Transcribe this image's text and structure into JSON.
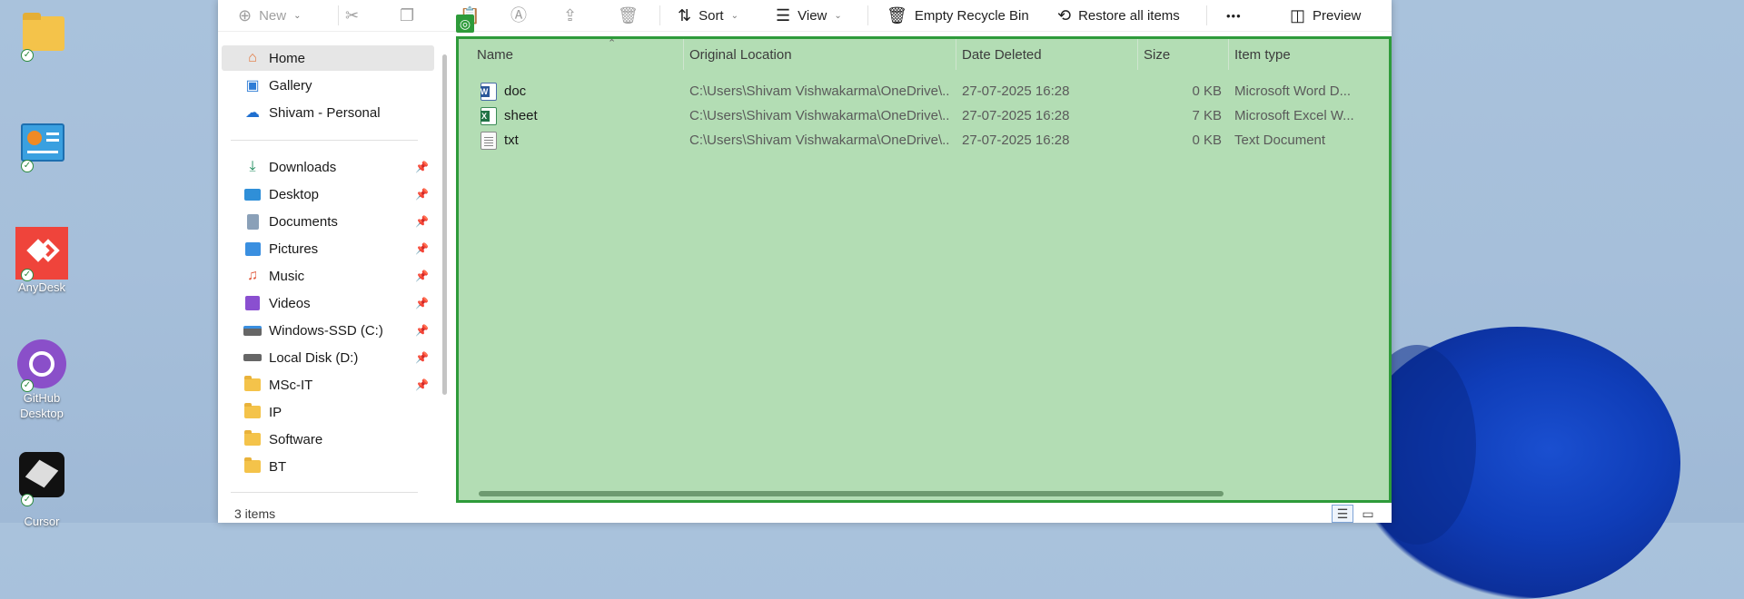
{
  "desktop": {
    "icons": [
      {
        "label": "",
        "icon": "folder-icon"
      },
      {
        "label": "",
        "icon": "control-panel-icon"
      },
      {
        "label": "AnyDesk",
        "icon": "anydesk-icon"
      },
      {
        "label": "GitHub Desktop",
        "icon": "github-icon"
      },
      {
        "label": "Cursor",
        "icon": "cursor-app-icon"
      }
    ]
  },
  "toolbar": {
    "new_label": "New",
    "sort_label": "Sort",
    "view_label": "View",
    "empty_label": "Empty Recycle Bin",
    "restore_label": "Restore all items",
    "more_label": "•••",
    "preview_label": "Preview"
  },
  "nav": {
    "quick": [
      {
        "label": "Home",
        "icon": "home-icon",
        "selected": true
      },
      {
        "label": "Gallery",
        "icon": "gallery-icon"
      },
      {
        "label": "Shivam - Personal",
        "icon": "onedrive-icon"
      }
    ],
    "pinned": [
      {
        "label": "Downloads",
        "icon": "download-icon"
      },
      {
        "label": "Desktop",
        "icon": "desktop-icon"
      },
      {
        "label": "Documents",
        "icon": "documents-icon"
      },
      {
        "label": "Pictures",
        "icon": "pictures-icon"
      },
      {
        "label": "Music",
        "icon": "music-icon"
      },
      {
        "label": "Videos",
        "icon": "videos-icon"
      },
      {
        "label": "Windows-SSD (C:)",
        "icon": "drive-icon"
      },
      {
        "label": "Local Disk (D:)",
        "icon": "drive-icon"
      },
      {
        "label": "MSc-IT",
        "icon": "folder-icon"
      }
    ],
    "folders": [
      {
        "label": "IP",
        "icon": "folder-icon"
      },
      {
        "label": "Software",
        "icon": "folder-icon"
      },
      {
        "label": "BT",
        "icon": "folder-icon"
      }
    ]
  },
  "table": {
    "columns": [
      "Name",
      "Original Location",
      "Date Deleted",
      "Size",
      "Item type"
    ],
    "rows": [
      {
        "name": "doc",
        "icon": "word-file-icon",
        "location": "C:\\Users\\Shivam Vishwakarma\\OneDrive\\...",
        "date": "27-07-2025 16:28",
        "size": "0 KB",
        "type": "Microsoft Word D..."
      },
      {
        "name": "sheet",
        "icon": "excel-file-icon",
        "location": "C:\\Users\\Shivam Vishwakarma\\OneDrive\\...",
        "date": "27-07-2025 16:28",
        "size": "7 KB",
        "type": "Microsoft Excel W..."
      },
      {
        "name": "txt",
        "icon": "text-file-icon",
        "location": "C:\\Users\\Shivam Vishwakarma\\OneDrive\\...",
        "date": "27-07-2025 16:28",
        "size": "0 KB",
        "type": "Text Document"
      }
    ]
  },
  "status": {
    "items_label": "3 items"
  }
}
